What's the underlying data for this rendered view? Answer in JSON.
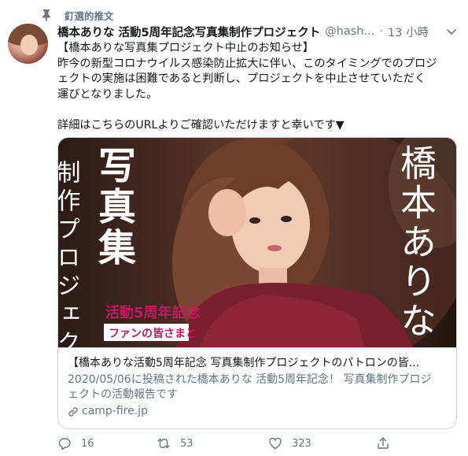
{
  "pinned": {
    "icon": "pin-icon",
    "label": "釘選的推文"
  },
  "author": {
    "display_name": "橋本ありな 活動5周年記念写真集制作プロジェクト",
    "handle": "@hash...",
    "separator": "·",
    "time": "13 小時"
  },
  "tweet": {
    "lines": [
      "【橋本ありな写真集プロジェクト中止のお知らせ】",
      "昨今の新型コロナウイルス感染防止拡大に伴い、このタイミングでのプロジ",
      "ェクトの実施は困難であると判断し、プロジェクトを中止させていただく",
      "運びとなりました。",
      "",
      "詳細はこちらのURLよりご確認いただけますと幸いです▼"
    ]
  },
  "card": {
    "image_text": {
      "left_col1": "制作プロジェクト",
      "left_col2": "写真集",
      "anniversary": "活動5周年記念",
      "fan_banner": "ファンの皆さまと",
      "right_col": "橋本ありな"
    },
    "title": "【橋本ありな活動5周年記念 写真集制作プロジェクトのパトロンの皆...",
    "description_lines": [
      "2020/05/06に投稿された橋本ありな 活動5周年記念！ 写真集制作プロジ",
      "ェクトの活動報告です"
    ],
    "domain": "camp-fire.jp"
  },
  "actions": {
    "reply_count": "16",
    "retweet_count": "53",
    "like_count": "323"
  },
  "colors": {
    "text": "#14171a",
    "secondary": "#657786",
    "border": "#ccd6dd",
    "magenta": "#c8175f"
  }
}
